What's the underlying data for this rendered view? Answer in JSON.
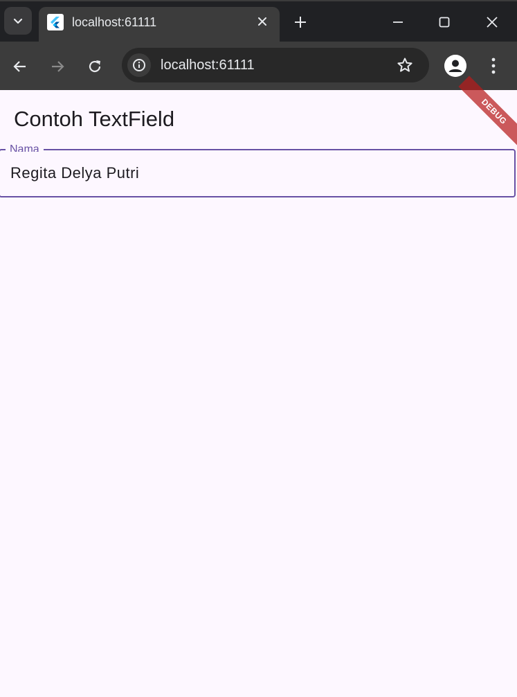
{
  "browser": {
    "tab_title": "localhost:61111",
    "url": "localhost:61111"
  },
  "app": {
    "title": "Contoh TextField",
    "field_label": "Nama",
    "field_value": "Regita Delya Putri",
    "accent_color": "#6750a4",
    "background_color": "#fdf7ff"
  },
  "debug_banner": "DEBUG",
  "icons": {
    "tab_search": "chevron-down-icon",
    "favicon": "flutter-icon",
    "close": "close-icon",
    "new_tab": "plus-icon",
    "minimize": "minimize-icon",
    "maximize": "maximize-icon",
    "window_close": "close-icon",
    "back": "arrow-left-icon",
    "forward": "arrow-right-icon",
    "reload": "reload-icon",
    "site_info": "info-icon",
    "bookmark": "star-icon",
    "profile": "person-icon",
    "menu": "more-vert-icon"
  }
}
